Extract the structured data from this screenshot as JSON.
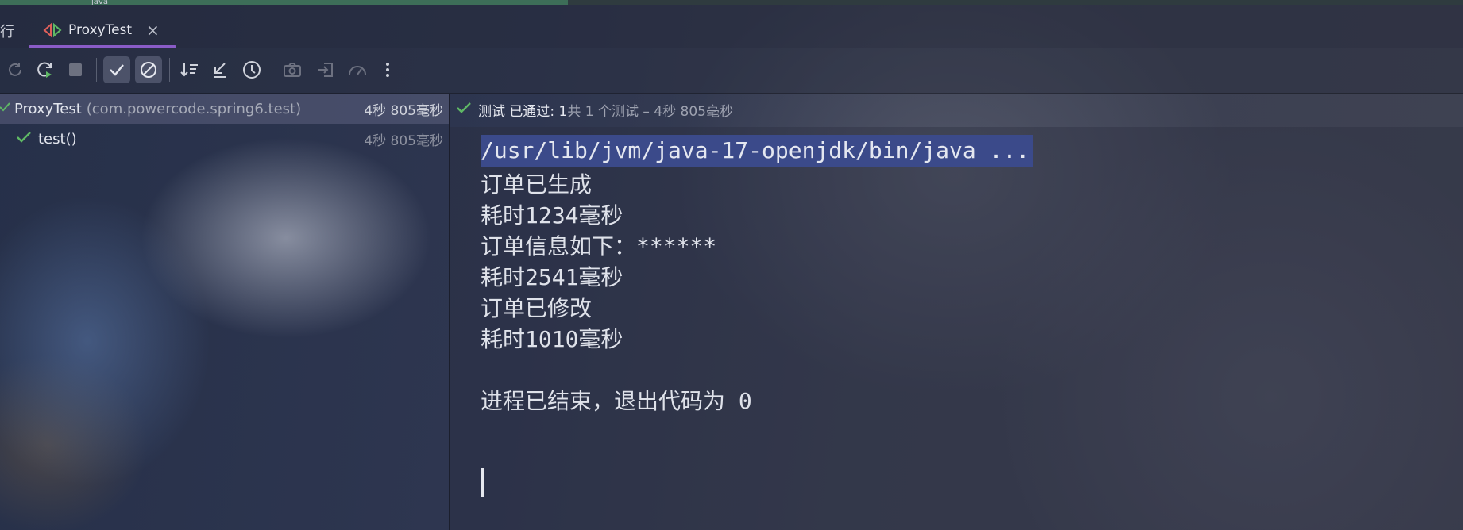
{
  "top_strip": {
    "partial_text": "java"
  },
  "tabbar": {
    "prev_tab_partial": "行",
    "active_tab": {
      "label": "ProxyTest",
      "icon": "test-run-icon",
      "close_icon": "close-icon"
    }
  },
  "toolbar": {
    "buttons": [
      {
        "icon": "rerun-icon",
        "enabled": false
      },
      {
        "icon": "rerun-failed-icon",
        "enabled": true
      },
      {
        "icon": "stop-icon",
        "enabled": false
      },
      {
        "icon": "show-passed-icon",
        "active": true
      },
      {
        "icon": "show-ignored-icon",
        "active": true
      },
      {
        "icon": "sort-alphabetically-icon"
      },
      {
        "icon": "sort-by-duration-icon"
      },
      {
        "icon": "history-icon"
      },
      {
        "icon": "camera-icon",
        "enabled": false
      },
      {
        "icon": "import-tests-icon",
        "enabled": false
      },
      {
        "icon": "profiler-icon",
        "enabled": false
      },
      {
        "icon": "more-options-icon"
      }
    ]
  },
  "tree": {
    "items": [
      {
        "name": "ProxyTest",
        "package": "(com.powercode.spring6.test)",
        "time": "4秒 805毫秒",
        "status": "passed",
        "selected": true
      },
      {
        "name": "test()",
        "time": "4秒 805毫秒",
        "status": "passed",
        "selected": false
      }
    ]
  },
  "status_bar": {
    "passed_text": "测试 已通过: 1",
    "detail_text": "共 1 个测试 – 4秒 805毫秒"
  },
  "console": {
    "lines": [
      "/usr/lib/jvm/java-17-openjdk/bin/java ...",
      "订单已生成",
      "耗时1234毫秒",
      "订单信息如下：******",
      "耗时2541毫秒",
      "订单已修改",
      "耗时1010毫秒",
      "",
      "进程已结束，退出代码为 0"
    ]
  },
  "colors": {
    "accent_purple": "#8a5cc7",
    "pass_green": "#5fb865",
    "command_highlight": "#3b4a8a"
  }
}
